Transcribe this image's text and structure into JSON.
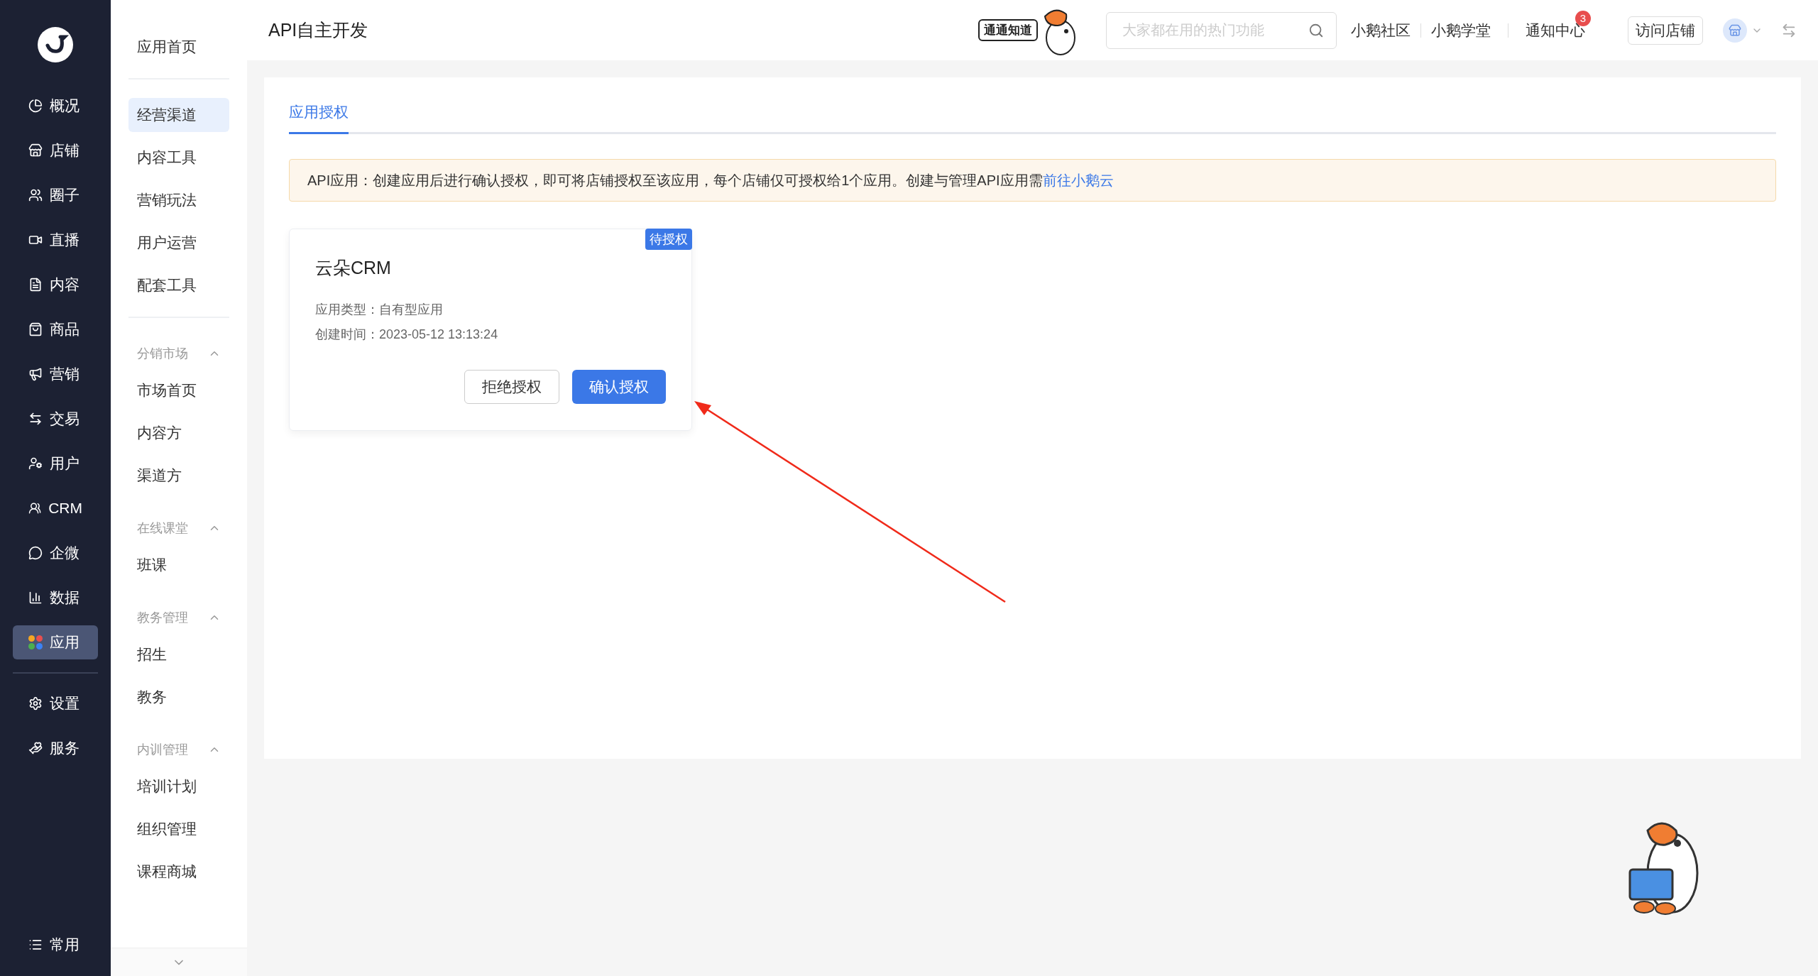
{
  "nav": [
    {
      "label": "概况",
      "selected": false
    },
    {
      "label": "店铺",
      "selected": false
    },
    {
      "label": "圈子",
      "selected": false
    },
    {
      "label": "直播",
      "selected": false
    },
    {
      "label": "内容",
      "selected": false
    },
    {
      "label": "商品",
      "selected": false
    },
    {
      "label": "营销",
      "selected": false
    },
    {
      "label": "交易",
      "selected": false
    },
    {
      "label": "用户",
      "selected": false
    },
    {
      "label": "CRM",
      "selected": false
    },
    {
      "label": "企微",
      "selected": false
    },
    {
      "label": "数据",
      "selected": false
    },
    {
      "label": "应用",
      "selected": true
    }
  ],
  "nav_bottom": [
    {
      "label": "设置",
      "selected": false
    },
    {
      "label": "服务",
      "selected": false
    }
  ],
  "nav_footer": "常用",
  "subnav": {
    "home": {
      "label": "应用首页",
      "selected": false
    },
    "tools": [
      {
        "label": "经营渠道",
        "selected": true
      },
      {
        "label": "内容工具",
        "selected": false
      },
      {
        "label": "营销玩法",
        "selected": false
      },
      {
        "label": "用户运营",
        "selected": false
      },
      {
        "label": "配套工具",
        "selected": false
      }
    ],
    "groups": [
      {
        "title": "分销市场",
        "expanded": true,
        "items": [
          {
            "label": "市场首页",
            "selected": false
          },
          {
            "label": "内容方",
            "selected": false
          },
          {
            "label": "渠道方",
            "selected": false
          }
        ]
      },
      {
        "title": "在线课堂",
        "expanded": true,
        "items": [
          {
            "label": "班课",
            "selected": false
          }
        ]
      },
      {
        "title": "教务管理",
        "expanded": true,
        "items": [
          {
            "label": "招生",
            "selected": false
          },
          {
            "label": "教务",
            "selected": false
          }
        ]
      },
      {
        "title": "内训管理",
        "expanded": true,
        "items": [
          {
            "label": "培训计划",
            "selected": false
          },
          {
            "label": "组织管理",
            "selected": false
          },
          {
            "label": "课程商城",
            "selected": false
          }
        ]
      }
    ]
  },
  "topbar": {
    "title": "API自主开发",
    "mascot_label": "通通知道",
    "search": {
      "placeholder": "大家都在用的热门功能"
    },
    "links": [
      "小鹅社区",
      "小鹅学堂"
    ],
    "notice": {
      "label": "通知中心",
      "count": "3"
    },
    "visit_button": "访问店铺"
  },
  "tabs": [
    {
      "label": "应用授权",
      "selected": true
    }
  ],
  "alert": {
    "text": "API应用：创建应用后进行确认授权，即可将店铺授权至该应用，每个店铺仅可授权给1个应用。创建与管理API应用需",
    "link": "前往小鹅云"
  },
  "apps": [
    {
      "name": "云朵CRM",
      "badge": "待授权",
      "fields": [
        {
          "label": "应用类型：",
          "value": "自有型应用"
        },
        {
          "label": "创建时间：",
          "value": "2023-05-12 13:13:24"
        }
      ],
      "buttons": [
        {
          "label": "拒绝授权",
          "kind": "secondary"
        },
        {
          "label": "确认授权",
          "kind": "primary"
        }
      ]
    }
  ]
}
